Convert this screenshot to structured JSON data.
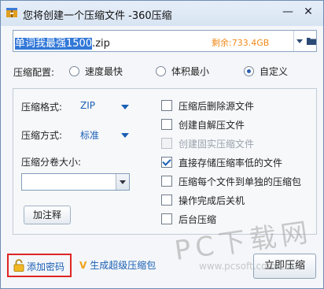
{
  "window": {
    "title": "您将创建一个压缩文件 -360压缩",
    "minimize": "—",
    "close": "✕"
  },
  "file": {
    "name_selected": "单词我最强1500",
    "name_ext": ".zip",
    "remaining": "剩余:733.4GB"
  },
  "config": {
    "label": "压缩配置:",
    "options": [
      {
        "label": "速度最快",
        "selected": false
      },
      {
        "label": "体积最小",
        "selected": false
      },
      {
        "label": "自定义",
        "selected": true
      }
    ]
  },
  "options": {
    "format_label": "压缩格式:",
    "format_value": "ZIP",
    "method_label": "压缩方式:",
    "method_value": "标准",
    "split_label": "压缩分卷大小:",
    "split_value": "",
    "annotate_button": "加注释"
  },
  "checkboxes": [
    {
      "label": "压缩后删除源文件",
      "checked": false,
      "enabled": true
    },
    {
      "label": "创建自解压文件",
      "checked": false,
      "enabled": true
    },
    {
      "label": "创建固实压缩文件",
      "checked": false,
      "enabled": false
    },
    {
      "label": "直接存储压缩率低的文件",
      "checked": true,
      "enabled": true
    },
    {
      "label": "压缩每个文件到单独的压缩包",
      "checked": false,
      "enabled": true
    },
    {
      "label": "操作完成后关机",
      "checked": false,
      "enabled": true
    },
    {
      "label": "后台压缩",
      "checked": false,
      "enabled": true
    }
  ],
  "footer": {
    "add_password": "添加密码",
    "super_zip": "生成超级压缩包",
    "compress_now": "立即压缩"
  },
  "watermark": {
    "text": "PC下载网",
    "url": "www.pcsoft.com.cn"
  },
  "colors": {
    "accent": "#1a5fb4",
    "highlight_border": "#e02424",
    "remaining": "#ef8a1b"
  }
}
